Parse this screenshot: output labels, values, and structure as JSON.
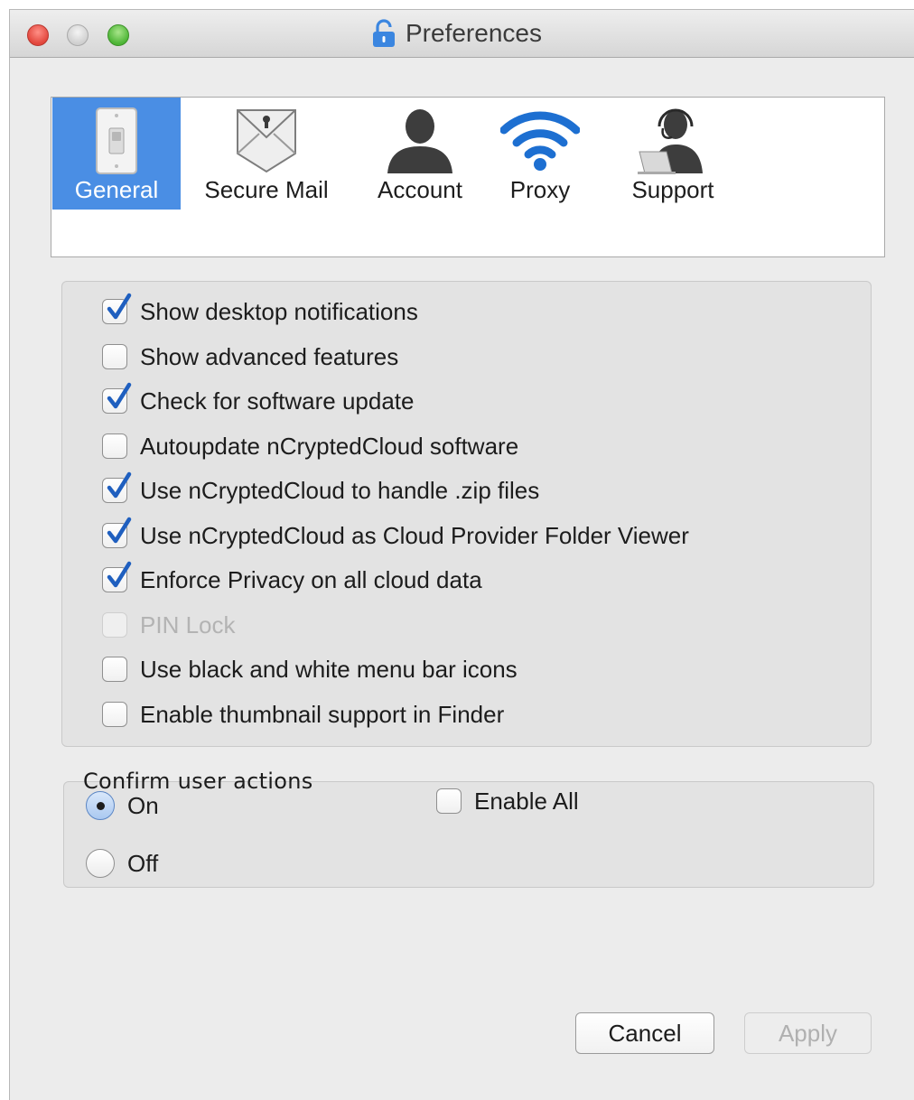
{
  "window": {
    "title": "Preferences",
    "icon": "lock-icon"
  },
  "tabs": [
    {
      "label": "General",
      "icon": "light-switch-icon",
      "active": true
    },
    {
      "label": "Secure Mail",
      "icon": "secure-envelope-icon",
      "active": false
    },
    {
      "label": "Account",
      "icon": "user-silhouette-icon",
      "active": false
    },
    {
      "label": "Proxy",
      "icon": "wifi-icon",
      "active": false
    },
    {
      "label": "Support",
      "icon": "headset-support-icon",
      "active": false
    }
  ],
  "options": [
    {
      "label": "Show desktop notifications",
      "checked": true,
      "enabled": true
    },
    {
      "label": "Show advanced features",
      "checked": false,
      "enabled": true
    },
    {
      "label": "Check for software update",
      "checked": true,
      "enabled": true
    },
    {
      "label": "Autoupdate nCryptedCloud software",
      "checked": false,
      "enabled": true
    },
    {
      "label": "Use nCryptedCloud to handle .zip files",
      "checked": true,
      "enabled": true
    },
    {
      "label": "Use nCryptedCloud as Cloud Provider Folder Viewer",
      "checked": true,
      "enabled": true
    },
    {
      "label": "Enforce Privacy on all cloud data",
      "checked": true,
      "enabled": true
    },
    {
      "label": "PIN Lock",
      "checked": false,
      "enabled": false
    },
    {
      "label": "Use black and white menu bar icons",
      "checked": false,
      "enabled": true
    },
    {
      "label": "Enable thumbnail support in Finder",
      "checked": false,
      "enabled": true
    }
  ],
  "confirm": {
    "title": "Confirm user actions",
    "on_label": "On",
    "off_label": "Off",
    "selected": "On",
    "enable_all_label": "Enable All",
    "enable_all_checked": false
  },
  "buttons": {
    "cancel": "Cancel",
    "apply": "Apply",
    "apply_enabled": false
  },
  "colors": {
    "selection": "#4a8ee4",
    "check_blue": "#1f5fbf"
  }
}
